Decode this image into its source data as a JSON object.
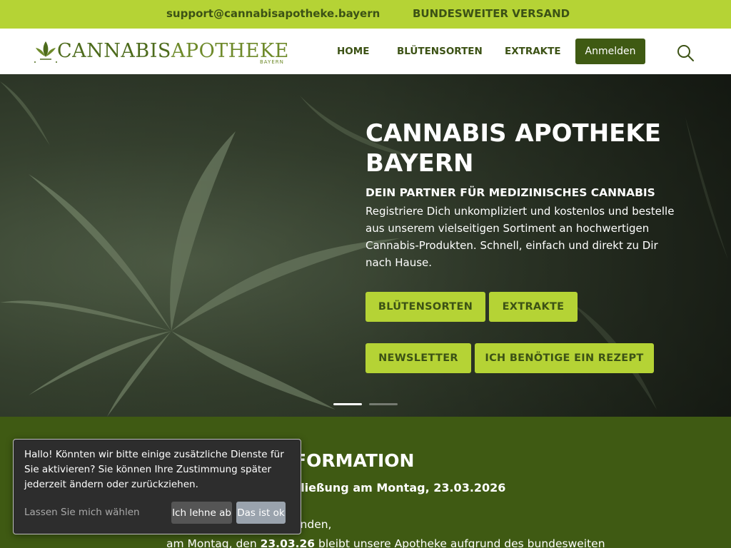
{
  "topbar": {
    "email": "support@cannabisapotheke.bayern",
    "shipping": "BUNDESWEITER VERSAND"
  },
  "header": {
    "logo_part1": "CANNABIS",
    "logo_part2": "APOTHEKE",
    "logo_sub": "BAYERN",
    "nav": {
      "home": "HOME",
      "blueten": "BLÜTENSORTEN",
      "extrakte": "EXTRAKTE"
    },
    "login_label": "Anmelden"
  },
  "hero": {
    "title": "CANNABIS APOTHEKE BAYERN",
    "subtitle": "DEIN PARTNER FÜR MEDIZINISCHES CANNABIS",
    "text": "Registriere Dich unkompliziert und kostenlos und bestelle aus unserem vielseitigen Sortiment an hochwertigen Cannabis-Produkten. Schnell, einfach und direkt zu Dir nach Hause.",
    "buttons": {
      "blueten": "BLÜTENSORTEN",
      "extrakte": "EXTRAKTE",
      "newsletter": "NEWSLETTER",
      "rezept": "ICH BENÖTIGE EIN REZEPT"
    }
  },
  "info": {
    "heading": "WICHTIGE INFORMATION",
    "closure": "Vorübergehende Schließung am Montag, 23.03.2026",
    "greeting": "Liebe Kundinnen und Kunden,",
    "line_start": "am Montag, den ",
    "line_date": "23.03.26",
    "line_end": " bleibt unsere Apotheke aufgrund des bundesweiten"
  },
  "cookie": {
    "message": "Hallo! Könnten wir bitte einige zusätzliche Dienste für Sie aktivieren? Sie können Ihre Zustimmung später jederzeit ändern oder zurückziehen.",
    "choose": "Lassen Sie mich wählen",
    "decline": "Ich lehne ab",
    "accept": "Das ist ok"
  },
  "colors": {
    "accent": "#b5d335",
    "dark_green": "#3f5a13",
    "text_green": "#3c5215"
  },
  "icons": [
    "cannabis-leaf-logo-icon",
    "search-icon"
  ]
}
